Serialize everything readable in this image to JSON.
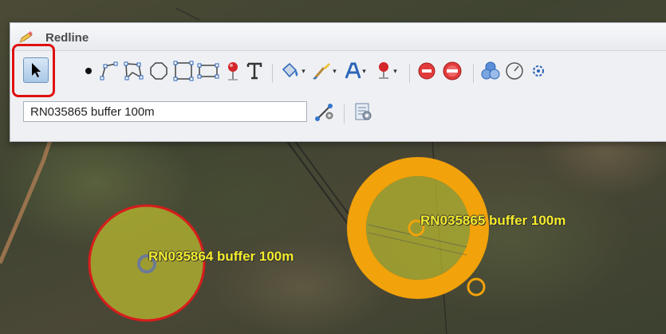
{
  "window": {
    "title": "Redline"
  },
  "toolbar": {
    "tools": [
      {
        "name": "select-arrow-icon"
      },
      {
        "name": "point-icon"
      },
      {
        "name": "polyline-icon"
      },
      {
        "name": "polygon-icon"
      },
      {
        "name": "circle-icon"
      },
      {
        "name": "rectangle-icon"
      },
      {
        "name": "square-icon"
      },
      {
        "name": "marker-pin-icon"
      },
      {
        "name": "text-icon"
      },
      {
        "name": "fill-color-icon",
        "dropdown": true
      },
      {
        "name": "line-color-icon",
        "dropdown": true
      },
      {
        "name": "font-icon",
        "dropdown": true
      },
      {
        "name": "marker-color-icon",
        "dropdown": true
      },
      {
        "name": "remove-icon"
      },
      {
        "name": "remove-all-icon"
      },
      {
        "name": "buffer-icon"
      },
      {
        "name": "measure-icon"
      },
      {
        "name": "more-icon"
      }
    ]
  },
  "label_input": {
    "value": "RN035865 buffer 100m"
  },
  "row2_tools": [
    {
      "name": "edit-nodes-icon"
    },
    {
      "name": "settings-icon"
    }
  ],
  "map": {
    "labels": [
      {
        "text": "RN035864 buffer 100m"
      },
      {
        "text": "RN035865 buffer 100m"
      }
    ]
  },
  "colors": {
    "buffer_fill": "#b5b530",
    "buffer_red_outline": "#d81c1c",
    "buffer_orange": "#f2a20a",
    "label": "#f4ec2a",
    "highlight": "#e01010"
  }
}
